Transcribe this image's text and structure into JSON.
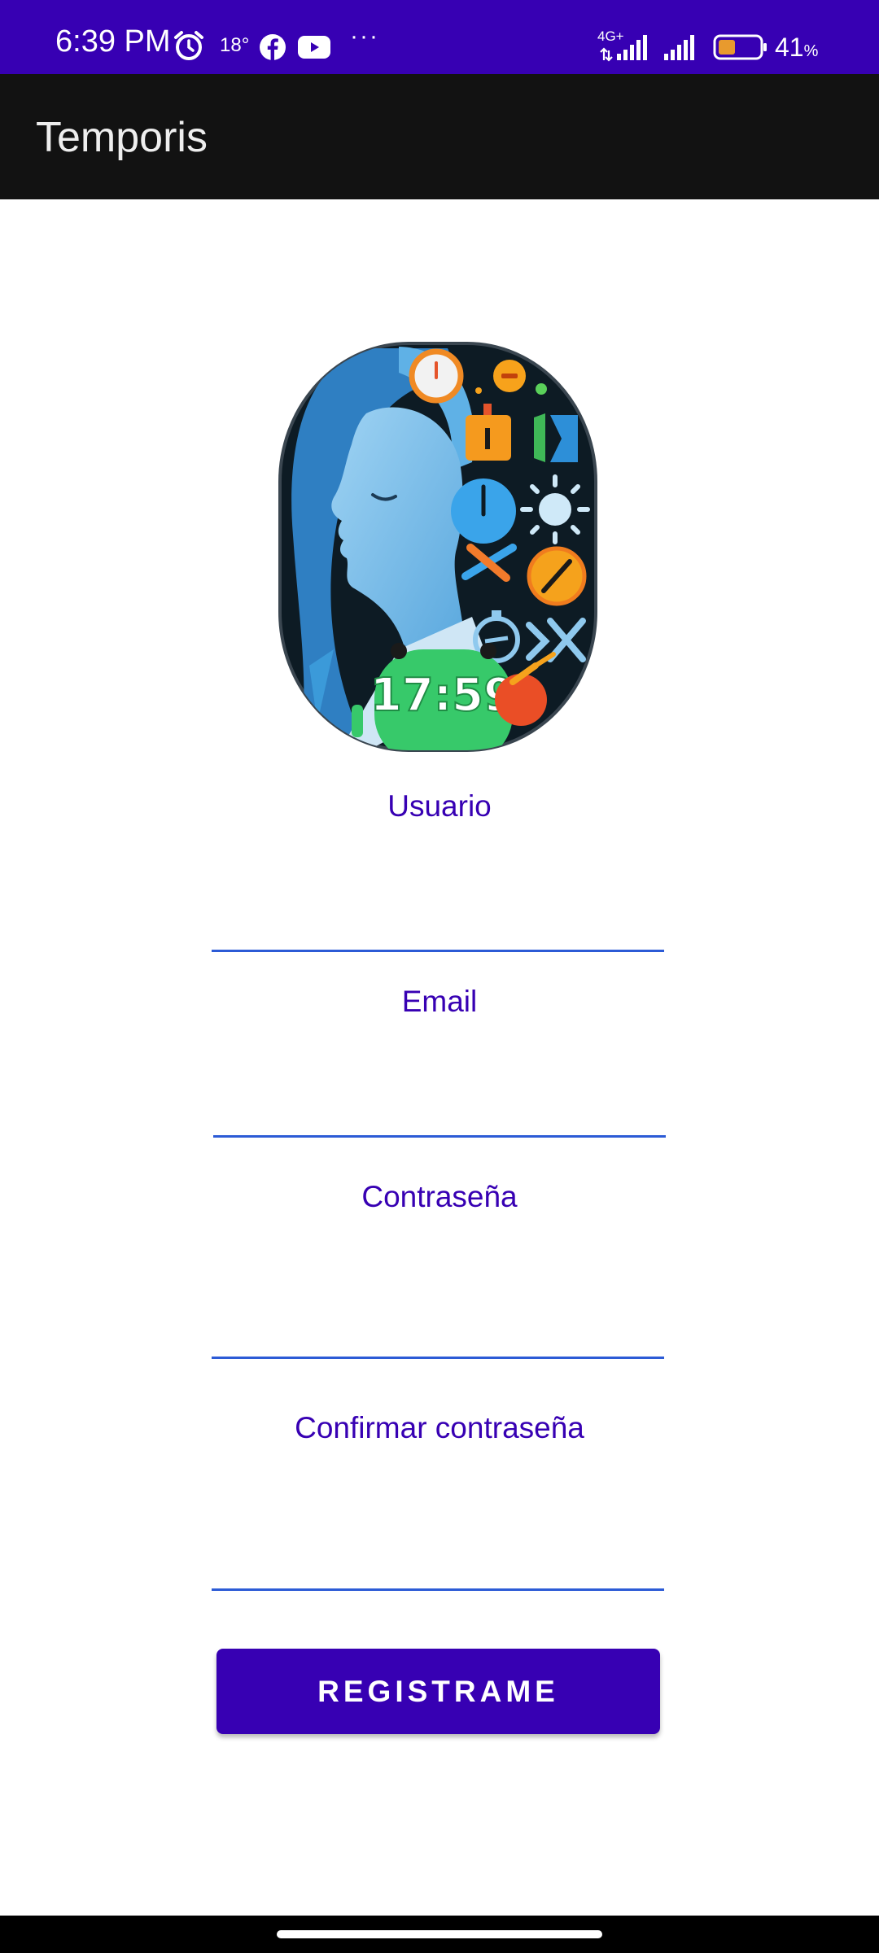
{
  "status_bar": {
    "time": "6:39 PM",
    "temperature": "18°",
    "more": "···",
    "network": "4G+",
    "battery_percent": "41",
    "battery_unit": "%",
    "icons": [
      "alarm-icon",
      "facebook-icon",
      "youtube-icon",
      "signal-icon",
      "battery-icon"
    ],
    "background_color": "#3700b3"
  },
  "app_bar": {
    "title": "Temporis",
    "background_color": "#121212"
  },
  "logo": {
    "clock_text": "17:59"
  },
  "form": {
    "username_label": "Usuario",
    "username_value": "",
    "email_label": "Email",
    "email_value": "",
    "password_label": "Contraseña",
    "password_value": "",
    "confirm_password_label": "Confirmar contraseña",
    "confirm_password_value": "",
    "accent_color": "#3700b3",
    "underline_color": "#2c5bd6"
  },
  "register_button": {
    "label": "REGISTRAME"
  }
}
